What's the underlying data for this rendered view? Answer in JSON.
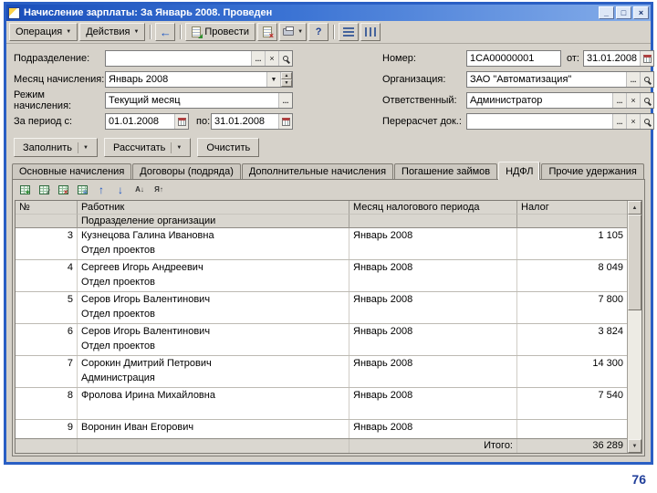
{
  "window": {
    "title": "Начисление зарплаты: За Январь 2008. Проведен"
  },
  "menubar": {
    "operation": "Операция",
    "actions": "Действия",
    "post": "Провести",
    "help": "?"
  },
  "form": {
    "department": {
      "label": "Подразделение:",
      "value": ""
    },
    "accrual_month": {
      "label": "Месяц начисления:",
      "value": "Январь 2008"
    },
    "accrual_mode": {
      "label": "Режим начисления:",
      "value": "Текущий месяц"
    },
    "period_from": {
      "label": "За период с:",
      "value": "01.01.2008"
    },
    "period_to": {
      "label": "по:",
      "value": "31.01.2008"
    },
    "number": {
      "label": "Номер:",
      "value": "1CA00000001"
    },
    "date": {
      "label": "от:",
      "value": "31.01.2008"
    },
    "organization": {
      "label": "Организация:",
      "value": "ЗАО \"Автоматизация\""
    },
    "responsible": {
      "label": "Ответственный:",
      "value": "Администратор"
    },
    "recalc_doc": {
      "label": "Перерасчет док.:",
      "value": ""
    }
  },
  "actions": {
    "fill": "Заполнить",
    "calculate": "Рассчитать",
    "clear": "Очистить"
  },
  "tabs": [
    {
      "label": "Основные начисления"
    },
    {
      "label": "Договоры (подряда)"
    },
    {
      "label": "Дополнительные начисления"
    },
    {
      "label": "Погашение займов"
    },
    {
      "label": "НДФЛ"
    },
    {
      "label": "Прочие удержания"
    }
  ],
  "table": {
    "headers": {
      "num": "№",
      "employee": "Работник",
      "employee_sub": "Подразделение организации",
      "tax_month": "Месяц налогового периода",
      "tax": "Налог"
    },
    "rows": [
      {
        "num": "3",
        "name": "Кузнецова Галина Ивановна",
        "dept": "Отдел проектов",
        "month": "Январь 2008",
        "tax": "1 105"
      },
      {
        "num": "4",
        "name": "Сергеев Игорь Андреевич",
        "dept": "Отдел проектов",
        "month": "Январь 2008",
        "tax": "8 049"
      },
      {
        "num": "5",
        "name": "Серов Игорь Валентинович",
        "dept": "Отдел проектов",
        "month": "Январь 2008",
        "tax": "7 800"
      },
      {
        "num": "6",
        "name": "Серов Игорь Валентинович",
        "dept": "Отдел проектов",
        "month": "Январь 2008",
        "tax": "3 824"
      },
      {
        "num": "7",
        "name": "Сорокин Дмитрий Петрович",
        "dept": "Администрация",
        "month": "Январь 2008",
        "tax": "14 300"
      },
      {
        "num": "8",
        "name": "Фролова Ирина Михайловна",
        "dept": "",
        "month": "Январь 2008",
        "tax": "7 540"
      },
      {
        "num": "9",
        "name": "Воронин Иван Егорович",
        "dept": "",
        "month": "Январь 2008",
        "tax": ""
      }
    ],
    "footer": {
      "label": "Итого:",
      "value": "36 289"
    }
  },
  "icons": {
    "dropdown": "▼",
    "spin_up": "▲",
    "spin_down": "▼",
    "ellipsis": "...",
    "clear": "×",
    "back": "←",
    "move_up": "↑",
    "move_down": "↓",
    "sort_asc": "А↓",
    "sort_desc": "Я↑",
    "scroll_up": "▲",
    "scroll_down": "▼",
    "minimize": "_",
    "maximize": "□",
    "close": "×",
    "add_overlay": "+",
    "edit_overlay": "∕",
    "delete_overlay": "×",
    "list_overlay": "≡"
  },
  "page_number": "76"
}
